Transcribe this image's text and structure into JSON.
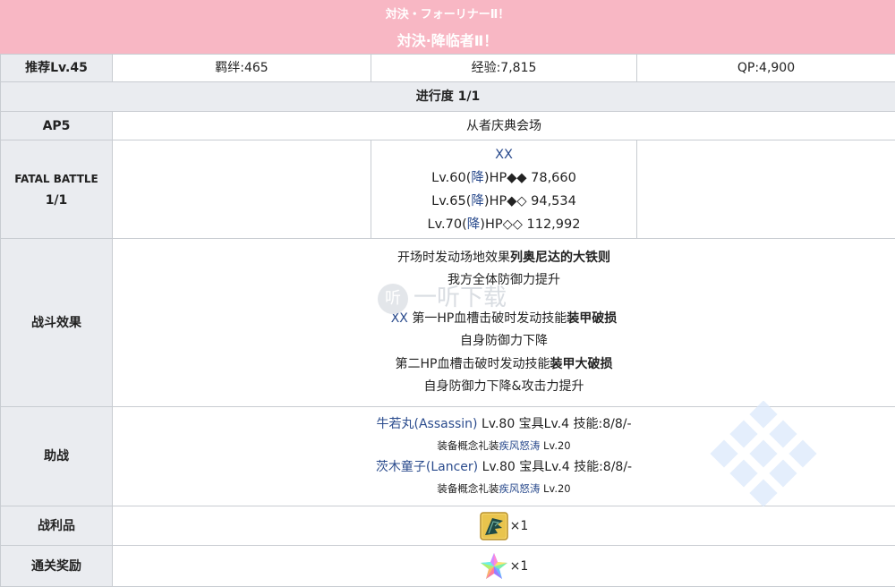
{
  "header": {
    "subtitle": "対決・フォーリナーⅡ！",
    "title": "対決·降临者Ⅱ！"
  },
  "stats": {
    "recommend": "推荐Lv.45",
    "bond": "羁绊:465",
    "exp": "经验:7,815",
    "qp": "QP:4,900"
  },
  "progress": "进行度 1/1",
  "ap": {
    "label": "AP5",
    "location": "从者庆典会场"
  },
  "fatal": {
    "label_line1": "FATAL BATTLE",
    "label_line2": "1/1",
    "enemy_name": "XX",
    "levels": [
      {
        "prefix": "Lv.60(",
        "cls": "降",
        "hp": ")HP◆◆ 78,660"
      },
      {
        "prefix": "Lv.65(",
        "cls": "降",
        "hp": ")HP◆◇ 94,534"
      },
      {
        "prefix": "Lv.70(",
        "cls": "降",
        "hp": ")HP◇◇ 112,992"
      }
    ]
  },
  "effects": {
    "label": "战斗效果",
    "line1_pre": "开场时发动场地效果",
    "line1_bold": "列奥尼达的大铁则",
    "line2": "我方全体防御力提升",
    "line3_link": "XX",
    "line3_pre": " 第一HP血槽击破时发动技能",
    "line3_bold": "装甲破损",
    "line4": "自身防御力下降",
    "line5_pre": "第二HP血槽击破时发动技能",
    "line5_bold": "装甲大破损",
    "line6": "自身防御力下降&攻击力提升"
  },
  "support": {
    "label": "助战",
    "s1_name": "牛若丸(Assassin)",
    "s1_info": " Lv.80 宝具Lv.4 技能:8/8/-",
    "s1_ce_pre": "装备概念礼装",
    "s1_ce": "疾风怒涛",
    "s1_ce_lv": " Lv.20",
    "s2_name": "茨木童子(Lancer)",
    "s2_info": " Lv.80 宝具Lv.4 技能:8/8/-",
    "s2_ce_pre": "装备概念礼装",
    "s2_ce": "疾风怒涛",
    "s2_ce_lv": " Lv.20"
  },
  "drops": {
    "label": "战利品",
    "icon": "dark-wing-item-icon",
    "qty": "×1"
  },
  "reward": {
    "label": "通关奖励",
    "icon": "rainbow-star-icon",
    "qty": "×1"
  },
  "watermark": {
    "glyph": "听",
    "text": "一听下载"
  },
  "colors": {
    "header_bg": "#f8b7c4",
    "label_bg": "#eaecf0",
    "link": "#2a4b8d",
    "border": "#c8ccd1"
  }
}
